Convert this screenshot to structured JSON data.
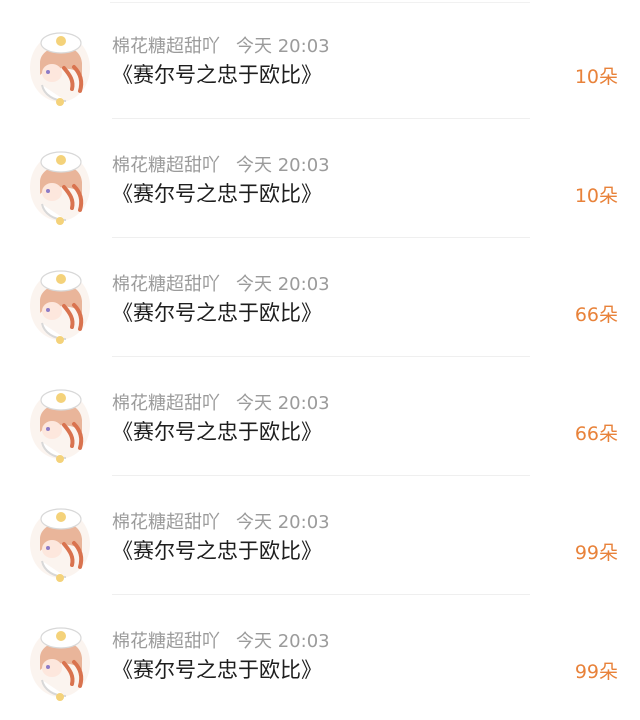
{
  "records": [
    {
      "name": "棉花糖超甜吖",
      "time": "今天 20:03",
      "gift": "《赛尔号之忠于欧比》",
      "amount": "10朵"
    },
    {
      "name": "棉花糖超甜吖",
      "time": "今天 20:03",
      "gift": "《赛尔号之忠于欧比》",
      "amount": "10朵"
    },
    {
      "name": "棉花糖超甜吖",
      "time": "今天 20:03",
      "gift": "《赛尔号之忠于欧比》",
      "amount": "66朵"
    },
    {
      "name": "棉花糖超甜吖",
      "time": "今天 20:03",
      "gift": "《赛尔号之忠于欧比》",
      "amount": "66朵"
    },
    {
      "name": "棉花糖超甜吖",
      "time": "今天 20:03",
      "gift": "《赛尔号之忠于欧比》",
      "amount": "99朵"
    },
    {
      "name": "棉花糖超甜吖",
      "time": "今天 20:03",
      "gift": "《赛尔号之忠于欧比》",
      "amount": "99朵"
    }
  ],
  "colors": {
    "amount": "#e8823a",
    "meta": "#9b9b9b",
    "title": "#1e1e1e"
  },
  "icons": {
    "avatar": "anime-girl-avatar-icon"
  }
}
